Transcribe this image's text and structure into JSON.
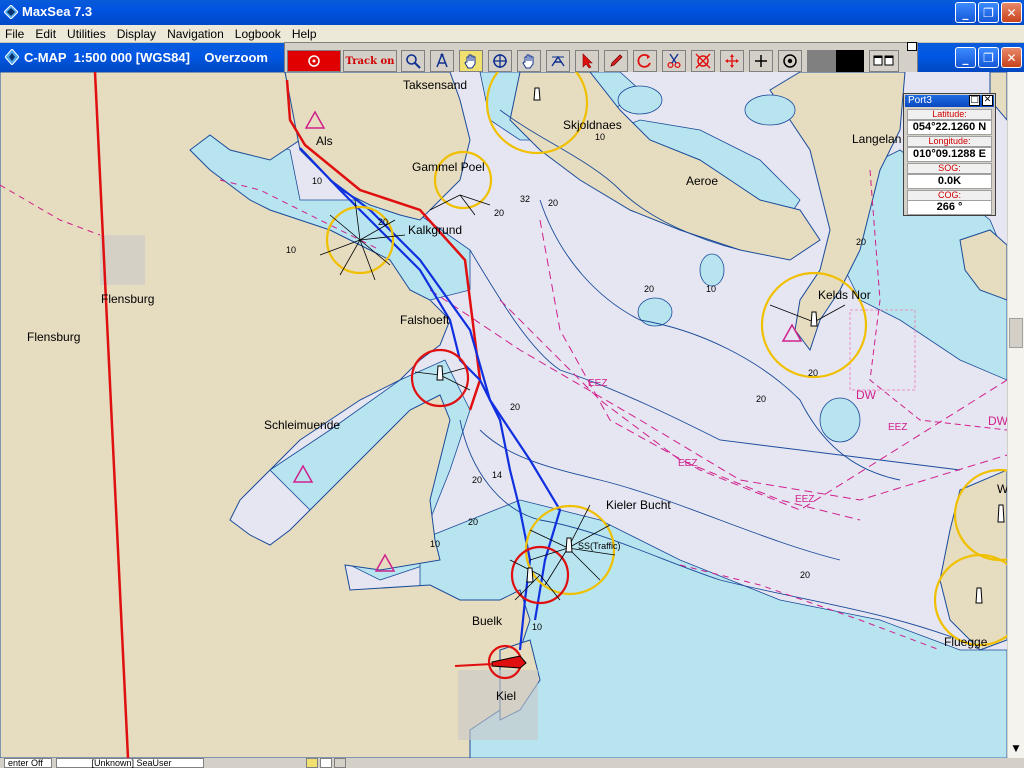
{
  "window": {
    "title": "MaxSea 7.3",
    "buttons": {
      "minimize": "_",
      "restore": "❐",
      "close": "✕"
    }
  },
  "menu": [
    "File",
    "Edit",
    "Utilities",
    "Display",
    "Navigation",
    "Logbook",
    "Help"
  ],
  "chart_window": {
    "title": "C-MAP  1:500 000 [WGS84]    Overzoom"
  },
  "toolbar": {
    "track_label": "Track on",
    "tools": [
      "mob-icon",
      "track-on",
      "zoom-icon",
      "anchor-compass-icon",
      "hand-pan-icon",
      "crosshair-icon",
      "hand-icon",
      "bearing-icon",
      "pointer-icon",
      "pencil-icon",
      "rotate-icon",
      "scissors-icon",
      "target-icon",
      "move-icon",
      "plus-icon",
      "center-icon",
      "window-icon"
    ]
  },
  "port_panel": {
    "title": "Port3",
    "latitude_label": "Latitude:",
    "latitude": "054°22.1260 N",
    "longitude_label": "Longitude:",
    "longitude": "010°09.1288 E",
    "sog_label": "SOG:",
    "sog": "0.0K",
    "cog_label": "COG:",
    "cog": "266 °"
  },
  "places": [
    {
      "id": "taksensand",
      "text": "Taksensand"
    },
    {
      "id": "skjoldnaes",
      "text": "Skjoldnaes"
    },
    {
      "id": "langeland",
      "text": "Langelan"
    },
    {
      "id": "als",
      "text": "Als"
    },
    {
      "id": "gammel-poel",
      "text": "Gammel Poel"
    },
    {
      "id": "aeroe",
      "text": "Aeroe"
    },
    {
      "id": "kalkgrund",
      "text": "Kalkgrund"
    },
    {
      "id": "flensburg1",
      "text": "Flensburg"
    },
    {
      "id": "flensburg2",
      "text": "Flensburg"
    },
    {
      "id": "kelds-nor",
      "text": "Kelds Nor"
    },
    {
      "id": "falshoeft",
      "text": "Falshoeft"
    },
    {
      "id": "schleimuende",
      "text": "Schleimuende"
    },
    {
      "id": "kieler-bucht",
      "text": "Kieler Bucht"
    },
    {
      "id": "traffic",
      "text": "SS(Traffic)"
    },
    {
      "id": "buelk",
      "text": "Buelk"
    },
    {
      "id": "kiel",
      "text": "Kiel"
    },
    {
      "id": "fluegge",
      "text": "Fluegge"
    },
    {
      "id": "w-edge",
      "text": "W"
    }
  ],
  "depths": [
    "10",
    "20",
    "32",
    "20",
    "10",
    "20",
    "20",
    "20",
    "14",
    "20",
    "10",
    "20",
    "10",
    "10",
    "20",
    "20",
    "10",
    "20",
    "20"
  ],
  "zone_labels": [
    "EEZ",
    "EEZ",
    "EEZ",
    "DW",
    "DW",
    "EEZ"
  ],
  "status": {
    "cell1": "enter Off",
    "cell2": "[Unknown] SeaUser"
  },
  "colors": {
    "land": "#e6dcc0",
    "shallow": "#b8e4f0",
    "deep": "#e6e6f2",
    "contour": "#1a4b9a",
    "track_blue": "#1030e0",
    "track_red": "#e01010",
    "zone_magenta": "#d0208c",
    "light_yellow": "#f0c000"
  }
}
